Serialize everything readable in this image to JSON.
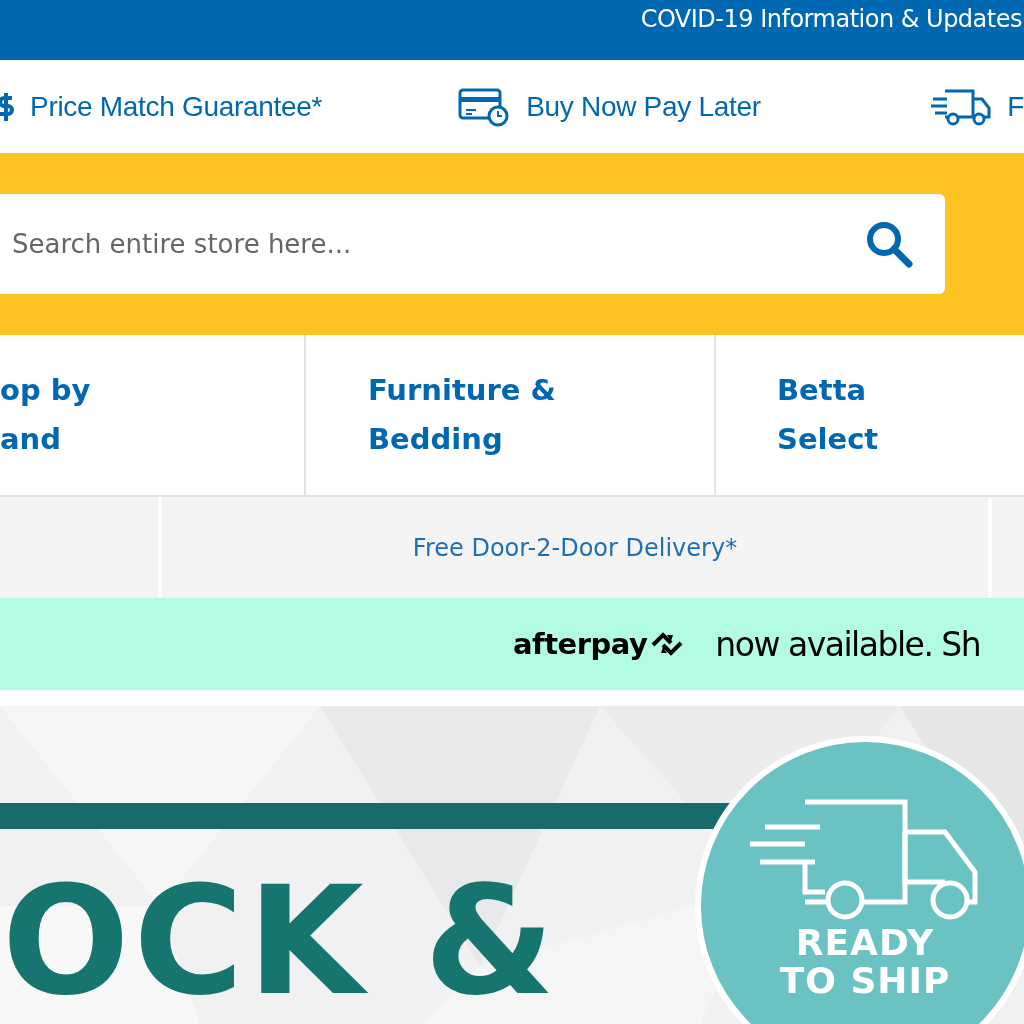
{
  "announcement": {
    "text": "COVID-19 Information & Updates"
  },
  "usps": [
    {
      "kind": "price",
      "label": "Price Match Guarantee*"
    },
    {
      "kind": "card",
      "label": "Buy Now Pay Later"
    },
    {
      "kind": "truck",
      "label": "F"
    }
  ],
  "search": {
    "placeholder": "Search entire store here..."
  },
  "nav": [
    {
      "label": "op by\nand"
    },
    {
      "label": "Furniture &\nBedding"
    },
    {
      "label": "Betta\nSelect"
    }
  ],
  "promo": {
    "text": "Free Door-2-Door Delivery*"
  },
  "afterpay": {
    "logo": "afterpay",
    "text": "now available. Sh"
  },
  "hero": {
    "headline": "OCK &",
    "badge_lines": [
      "READY",
      "TO SHIP"
    ]
  }
}
